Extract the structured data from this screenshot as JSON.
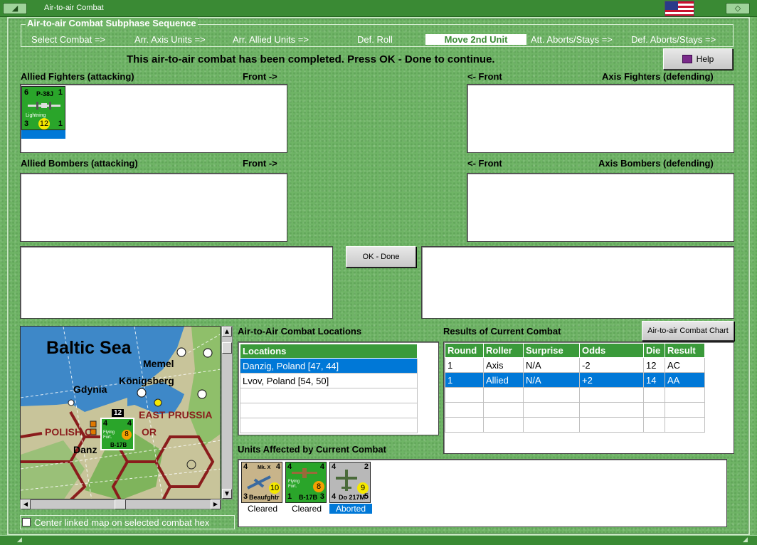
{
  "window": {
    "title": "Air-to-air Combat"
  },
  "subphase": {
    "legend": "Air-to-air Combat Subphase Sequence",
    "steps": [
      "Select Combat =>",
      "Arr. Axis Units =>",
      "Arr. Allied Units =>",
      "Def. Roll",
      "Move 2nd Unit",
      "Att. Aborts/Stays =>",
      "Def. Aborts/Stays =>"
    ],
    "active_index": 4
  },
  "message": "This air-to-air combat has been completed.  Press OK - Done to continue.",
  "help_label": "Help",
  "sections": {
    "allied_fighters": "Allied Fighters (attacking)",
    "axis_fighters": "Axis Fighters (defending)",
    "allied_bombers": "Allied Bombers (attacking)",
    "axis_bombers": "Axis Bombers (defending)",
    "front_right": "Front ->",
    "front_left": "<- Front"
  },
  "allied_fighter_unit": {
    "top_left": "6",
    "top_right": "1",
    "name": "P-38J",
    "subtitle": "Lightning",
    "bottom_left": "3",
    "bottom_right": "1",
    "value": "12"
  },
  "ok_done_label": "OK - Done",
  "locations": {
    "heading": "Air-to-Air Combat Locations",
    "column": "Locations",
    "rows": [
      "Danzig, Poland [47, 44]",
      "Lvov, Poland [54, 50]",
      "",
      "",
      ""
    ],
    "selected_index": 0
  },
  "results": {
    "heading": "Results of Current Combat",
    "chart_button": "Air-to-air Combat Chart",
    "columns": [
      "Round",
      "Roller",
      "Surprise",
      "Odds",
      "Die",
      "Result"
    ],
    "rows": [
      [
        "1",
        "Axis",
        "N/A",
        "-2",
        "12",
        "AC"
      ],
      [
        "1",
        "Allied",
        "N/A",
        "+2",
        "14",
        "AA"
      ],
      [
        "",
        "",
        "",
        "",
        "",
        ""
      ],
      [
        "",
        "",
        "",
        "",
        "",
        ""
      ],
      [
        "",
        "",
        "",
        "",
        "",
        ""
      ]
    ],
    "selected_index": 1
  },
  "units_affected": {
    "heading": "Units Affected by Current Combat",
    "units": [
      {
        "top_left": "4",
        "top_right": "4",
        "tag": "Mk. X",
        "value": "10",
        "bottom_left": "3",
        "name": "Beaufghtr",
        "status": "Cleared",
        "color": "#c8b48a"
      },
      {
        "top_left": "4",
        "top_right": "4",
        "tag": "Flying Fort.",
        "value": "8",
        "bottom_left": "1",
        "bottom_right": "3",
        "name": "B-17B",
        "status": "Cleared",
        "color": "#2aa52a"
      },
      {
        "top_left": "4",
        "top_right": "2",
        "tag": "",
        "value": "9",
        "bottom_left": "4",
        "bottom_right": "5",
        "name": "Do 217M",
        "status": "Aborted",
        "color": "#b8b8b8"
      }
    ]
  },
  "map": {
    "labels": [
      "Baltic Sea",
      "Memel",
      "Königsberg",
      "Gdynia",
      "EAST PRUSSIA",
      "POLISH C",
      "OR",
      "Danz"
    ],
    "stack_count": "12",
    "unit": {
      "top_left": "4",
      "top_right": "4",
      "tag": "Flying Fort.",
      "value": "8",
      "name": "B-17B"
    }
  },
  "center_map_label": "Center linked map on selected combat hex"
}
